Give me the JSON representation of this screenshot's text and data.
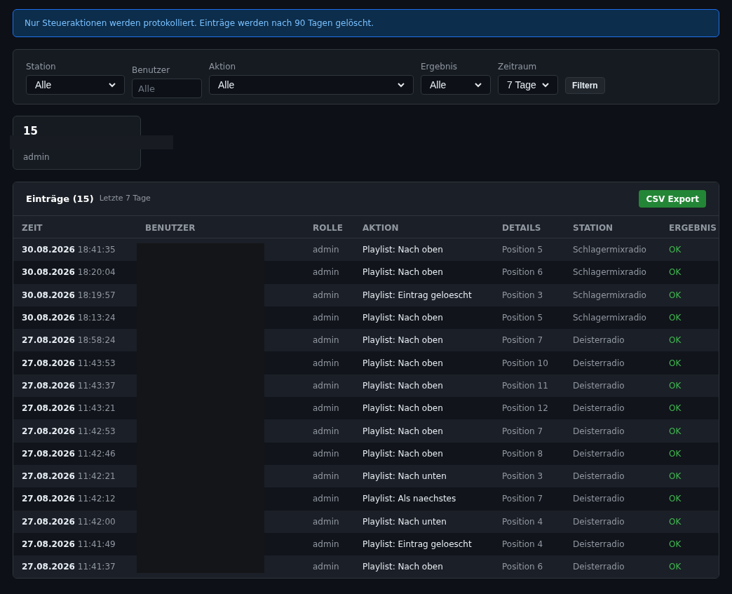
{
  "notice": "Nur Steueraktionen werden protokolliert. Einträge werden nach 90 Tagen gelöscht.",
  "filters": [
    {
      "label": "Station",
      "kind": "select",
      "value": "Alle"
    },
    {
      "label": "Benutzer",
      "kind": "input",
      "placeholder": "Alle"
    },
    {
      "label": "Aktion",
      "kind": "select",
      "value": "Alle"
    },
    {
      "label": "Ergebnis",
      "kind": "select",
      "value": "Alle"
    },
    {
      "label": "Zeitraum",
      "kind": "select",
      "value": "7 Tage"
    }
  ],
  "filter_button": "Filtern",
  "stat_card": {
    "value": "15",
    "label": "admin"
  },
  "table": {
    "title": "Einträge (15)",
    "subtitle": "Letzte 7 Tage",
    "export_button": "CSV Export",
    "columns": [
      "ZEIT",
      "BENUTZER",
      "ROLLE",
      "AKTION",
      "DETAILS",
      "STATION",
      "ERGEBNIS"
    ],
    "rows": [
      {
        "date": "30.08.2026",
        "time": "18:41:35",
        "role": "admin",
        "action": "Playlist: Nach oben",
        "details": "Position 5",
        "station": "Schlagermixradio",
        "result": "OK"
      },
      {
        "date": "30.08.2026",
        "time": "18:20:04",
        "role": "admin",
        "action": "Playlist: Nach oben",
        "details": "Position 6",
        "station": "Schlagermixradio",
        "result": "OK"
      },
      {
        "date": "30.08.2026",
        "time": "18:19:57",
        "role": "admin",
        "action": "Playlist: Eintrag geloescht",
        "details": "Position 3",
        "station": "Schlagermixradio",
        "result": "OK"
      },
      {
        "date": "30.08.2026",
        "time": "18:13:24",
        "role": "admin",
        "action": "Playlist: Nach oben",
        "details": "Position 5",
        "station": "Schlagermixradio",
        "result": "OK"
      },
      {
        "date": "27.08.2026",
        "time": "18:58:24",
        "role": "admin",
        "action": "Playlist: Nach oben",
        "details": "Position 7",
        "station": "Deisterradio",
        "result": "OK"
      },
      {
        "date": "27.08.2026",
        "time": "11:43:53",
        "role": "admin",
        "action": "Playlist: Nach oben",
        "details": "Position 10",
        "station": "Deisterradio",
        "result": "OK"
      },
      {
        "date": "27.08.2026",
        "time": "11:43:37",
        "role": "admin",
        "action": "Playlist: Nach oben",
        "details": "Position 11",
        "station": "Deisterradio",
        "result": "OK"
      },
      {
        "date": "27.08.2026",
        "time": "11:43:21",
        "role": "admin",
        "action": "Playlist: Nach oben",
        "details": "Position 12",
        "station": "Deisterradio",
        "result": "OK"
      },
      {
        "date": "27.08.2026",
        "time": "11:42:53",
        "role": "admin",
        "action": "Playlist: Nach oben",
        "details": "Position 7",
        "station": "Deisterradio",
        "result": "OK"
      },
      {
        "date": "27.08.2026",
        "time": "11:42:46",
        "role": "admin",
        "action": "Playlist: Nach oben",
        "details": "Position 8",
        "station": "Deisterradio",
        "result": "OK"
      },
      {
        "date": "27.08.2026",
        "time": "11:42:21",
        "role": "admin",
        "action": "Playlist: Nach unten",
        "details": "Position 3",
        "station": "Deisterradio",
        "result": "OK"
      },
      {
        "date": "27.08.2026",
        "time": "11:42:12",
        "role": "admin",
        "action": "Playlist: Als naechstes",
        "details": "Position 7",
        "station": "Deisterradio",
        "result": "OK"
      },
      {
        "date": "27.08.2026",
        "time": "11:42:00",
        "role": "admin",
        "action": "Playlist: Nach unten",
        "details": "Position 4",
        "station": "Deisterradio",
        "result": "OK"
      },
      {
        "date": "27.08.2026",
        "time": "11:41:49",
        "role": "admin",
        "action": "Playlist: Eintrag geloescht",
        "details": "Position 4",
        "station": "Deisterradio",
        "result": "OK"
      },
      {
        "date": "27.08.2026",
        "time": "11:41:37",
        "role": "admin",
        "action": "Playlist: Nach oben",
        "details": "Position 6",
        "station": "Deisterradio",
        "result": "OK"
      }
    ]
  }
}
